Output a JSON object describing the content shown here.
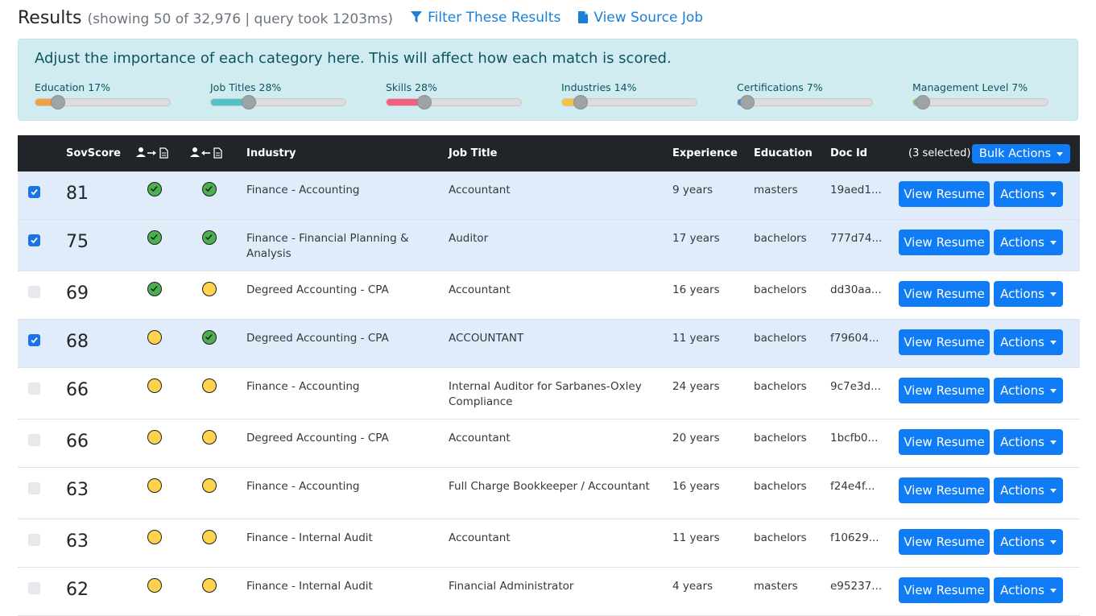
{
  "header": {
    "title": "Results",
    "subtitle": "(showing 50 of 32,976 | query took 1203ms)",
    "filter_label": "Filter These Results",
    "source_label": "View Source Job"
  },
  "weights": {
    "heading": "Adjust the importance of each category here. This will affect how each match is scored.",
    "categories": [
      {
        "label": "Education 17%",
        "value": 17,
        "color": "#f0a040"
      },
      {
        "label": "Job Titles 28%",
        "value": 28,
        "color": "#4fc3c7"
      },
      {
        "label": "Skills 28%",
        "value": 28,
        "color": "#f06080"
      },
      {
        "label": "Industries 14%",
        "value": 14,
        "color": "#f5c242"
      },
      {
        "label": "Certifications 7%",
        "value": 7,
        "color": "#3b8fd6"
      },
      {
        "label": "Management Level 7%",
        "value": 7,
        "color": "#7bc96f"
      }
    ]
  },
  "table": {
    "headers": {
      "score": "SovScore",
      "industry": "Industry",
      "job_title": "Job Title",
      "experience": "Experience",
      "education": "Education",
      "doc_id": "Doc Id",
      "selected": "(3 selected)",
      "bulk_actions": "Bulk Actions"
    },
    "view_resume": "View Resume",
    "actions": "Actions",
    "rows": [
      {
        "checked": true,
        "score": "81",
        "s1": "green",
        "s2": "green",
        "industry": "Finance - Accounting",
        "job_title": "Accountant",
        "experience": "9 years",
        "education": "masters",
        "doc_id": "19aed1..."
      },
      {
        "checked": true,
        "score": "75",
        "s1": "green",
        "s2": "green",
        "industry": "Finance - Financial Planning & Analysis",
        "job_title": "Auditor",
        "experience": "17 years",
        "education": "bachelors",
        "doc_id": "777d74..."
      },
      {
        "checked": false,
        "score": "69",
        "s1": "green",
        "s2": "yellow",
        "industry": "Degreed Accounting - CPA",
        "job_title": "Accountant",
        "experience": "16 years",
        "education": "bachelors",
        "doc_id": "dd30aa..."
      },
      {
        "checked": true,
        "score": "68",
        "s1": "yellow",
        "s2": "green",
        "industry": "Degreed Accounting - CPA",
        "job_title": "ACCOUNTANT",
        "experience": "11 years",
        "education": "bachelors",
        "doc_id": "f79604..."
      },
      {
        "checked": false,
        "score": "66",
        "s1": "yellow",
        "s2": "yellow",
        "industry": "Finance - Accounting",
        "job_title": "Internal Auditor for Sarbanes-Oxley Compliance",
        "experience": "24 years",
        "education": "bachelors",
        "doc_id": "9c7e3d..."
      },
      {
        "checked": false,
        "score": "66",
        "s1": "yellow",
        "s2": "yellow",
        "industry": "Degreed Accounting - CPA",
        "job_title": "Accountant",
        "experience": "20 years",
        "education": "bachelors",
        "doc_id": "1bcfb0..."
      },
      {
        "checked": false,
        "score": "63",
        "s1": "yellow",
        "s2": "yellow",
        "industry": "Finance - Accounting",
        "job_title": "Full Charge Bookkeeper / Accountant",
        "experience": "16 years",
        "education": "bachelors",
        "doc_id": "f24e4f..."
      },
      {
        "checked": false,
        "score": "63",
        "s1": "yellow",
        "s2": "yellow",
        "industry": "Finance - Internal Audit",
        "job_title": "Accountant",
        "experience": "11 years",
        "education": "bachelors",
        "doc_id": "f10629..."
      },
      {
        "checked": false,
        "score": "62",
        "s1": "yellow",
        "s2": "yellow",
        "industry": "Finance - Internal Audit",
        "job_title": "Financial Administrator",
        "experience": "4 years",
        "education": "masters",
        "doc_id": "e95237..."
      }
    ]
  }
}
